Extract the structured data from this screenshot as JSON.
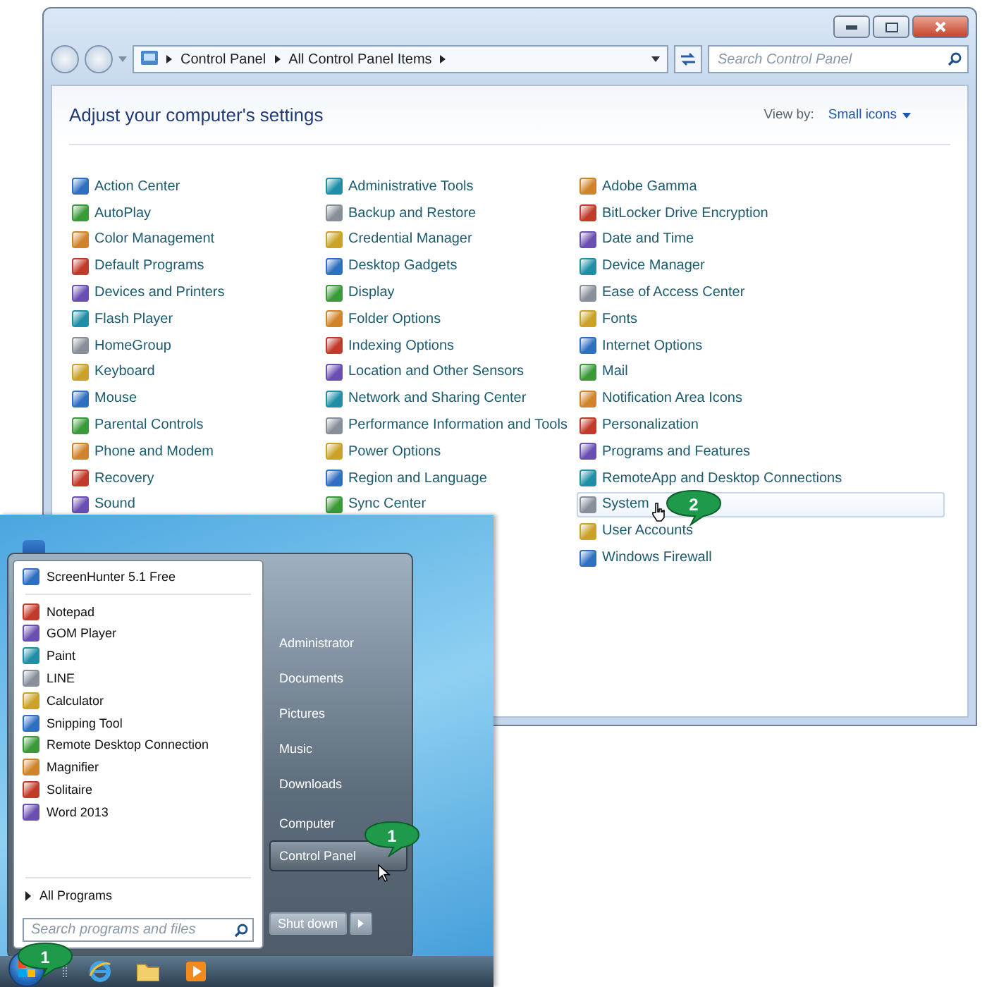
{
  "control_panel": {
    "breadcrumb": [
      "Control Panel",
      "All Control Panel Items"
    ],
    "search": {
      "placeholder": "Search Control Panel"
    },
    "heading": "Adjust your computer's settings",
    "view_by": {
      "label": "View by:",
      "value": "Small icons"
    },
    "columns": [
      [
        {
          "label": "Action Center",
          "selected": false
        },
        {
          "label": "AutoPlay",
          "selected": false
        },
        {
          "label": "Color Management",
          "selected": false
        },
        {
          "label": "Default Programs",
          "selected": false
        },
        {
          "label": "Devices and Printers",
          "selected": false
        },
        {
          "label": "Flash Player",
          "selected": false
        },
        {
          "label": "HomeGroup",
          "selected": false
        },
        {
          "label": "Keyboard",
          "selected": false
        },
        {
          "label": "Mouse",
          "selected": false
        },
        {
          "label": "Parental Controls",
          "selected": false
        },
        {
          "label": "Phone and Modem",
          "selected": false
        },
        {
          "label": "Recovery",
          "selected": false
        },
        {
          "label": "Sound",
          "selected": false
        }
      ],
      [
        {
          "label": "Administrative Tools",
          "selected": false
        },
        {
          "label": "Backup and Restore",
          "selected": false
        },
        {
          "label": "Credential Manager",
          "selected": false
        },
        {
          "label": "Desktop Gadgets",
          "selected": false
        },
        {
          "label": "Display",
          "selected": false
        },
        {
          "label": "Folder Options",
          "selected": false
        },
        {
          "label": "Indexing Options",
          "selected": false
        },
        {
          "label": "Location and Other Sensors",
          "selected": false
        },
        {
          "label": "Network and Sharing Center",
          "selected": false
        },
        {
          "label": "Performance Information and Tools",
          "selected": false
        },
        {
          "label": "Power Options",
          "selected": false
        },
        {
          "label": "Region and Language",
          "selected": false
        },
        {
          "label": "Sync Center",
          "selected": false
        }
      ],
      [
        {
          "label": "Adobe Gamma",
          "selected": false
        },
        {
          "label": "BitLocker Drive Encryption",
          "selected": false
        },
        {
          "label": "Date and Time",
          "selected": false
        },
        {
          "label": "Device Manager",
          "selected": false
        },
        {
          "label": "Ease of Access Center",
          "selected": false
        },
        {
          "label": "Fonts",
          "selected": false
        },
        {
          "label": "Internet Options",
          "selected": false
        },
        {
          "label": "Mail",
          "selected": false
        },
        {
          "label": "Notification Area Icons",
          "selected": false
        },
        {
          "label": "Personalization",
          "selected": false
        },
        {
          "label": "Programs and Features",
          "selected": false
        },
        {
          "label": "RemoteApp and Desktop Connections",
          "selected": false
        },
        {
          "label": "System",
          "selected": true,
          "callout": "2"
        },
        {
          "label": "User Accounts",
          "selected": false
        },
        {
          "label": "Windows Firewall",
          "selected": false
        }
      ]
    ]
  },
  "start_menu": {
    "pinned": [
      "ScreenHunter 5.1 Free"
    ],
    "recent": [
      "Notepad",
      "GOM Player",
      "Paint",
      "LINE",
      "Calculator",
      "Snipping Tool",
      "Remote Desktop Connection",
      "Magnifier",
      "Solitaire",
      "Word 2013"
    ],
    "all_programs": "All Programs",
    "search": {
      "placeholder": "Search programs and files"
    },
    "places": [
      {
        "label": "Administrator",
        "selected": false
      },
      {
        "label": "Documents",
        "selected": false
      },
      {
        "label": "Pictures",
        "selected": false
      },
      {
        "label": "Music",
        "selected": false
      },
      {
        "label": "Downloads",
        "selected": false
      },
      {
        "label": "Computer",
        "selected": false
      },
      {
        "label": "Control Panel",
        "selected": true,
        "callout": "1"
      }
    ],
    "shutdown": "Shut down"
  },
  "taskbar": {
    "start_callout": "1",
    "apps": [
      {
        "kind": "browser"
      },
      {
        "kind": "folder"
      },
      {
        "kind": "media"
      }
    ]
  }
}
